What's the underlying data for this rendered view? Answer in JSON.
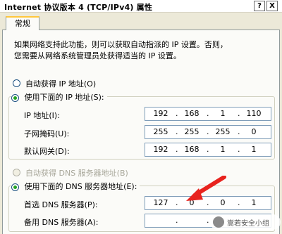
{
  "window": {
    "title": "Internet 协议版本 4 (TCP/IPv4) 属性",
    "help_button": "?",
    "close_button": "X"
  },
  "tabs": [
    {
      "label": "常规"
    }
  ],
  "general": {
    "description_line1": "如果网络支持此功能，则可以获取自动指派的 IP 设置。否则，",
    "description_line2": "您需要从网络系统管理员处获得适当的 IP 设置。",
    "ip_auto_label": "自动获得 IP 地址(O)",
    "ip_manual_label": "使用下面的 IP 地址(S):",
    "ip_address_label": "IP 地址(I):",
    "subnet_label": "子网掩码(U):",
    "gateway_label": "默认网关(D):",
    "ip_address": [
      "192",
      "168",
      "1",
      "110"
    ],
    "subnet_mask": [
      "255",
      "255",
      "255",
      "0"
    ],
    "gateway": [
      "192",
      "168",
      "1",
      "1"
    ],
    "dns_auto_label": "自动获得 DNS 服务器地址(B)",
    "dns_manual_label": "使用下面的 DNS 服务器地址(E):",
    "preferred_dns_label": "首选 DNS 服务器(P):",
    "alternate_dns_label": "备用 DNS 服务器(A):",
    "preferred_dns": [
      "127",
      "0",
      "0",
      "1"
    ],
    "alternate_dns": [
      "",
      "",
      "",
      ""
    ],
    "ip_mode": "manual",
    "dns_mode": "manual"
  },
  "watermark": {
    "text": "嵩若安全小组"
  },
  "colors": {
    "window_bg": "#ece9d8",
    "panel_bg": "#fbfbf8",
    "field_border": "#7f9db9",
    "radio_check": "#21a121",
    "tab_accent": "#ffc73c",
    "arrow": "#e8231e"
  }
}
